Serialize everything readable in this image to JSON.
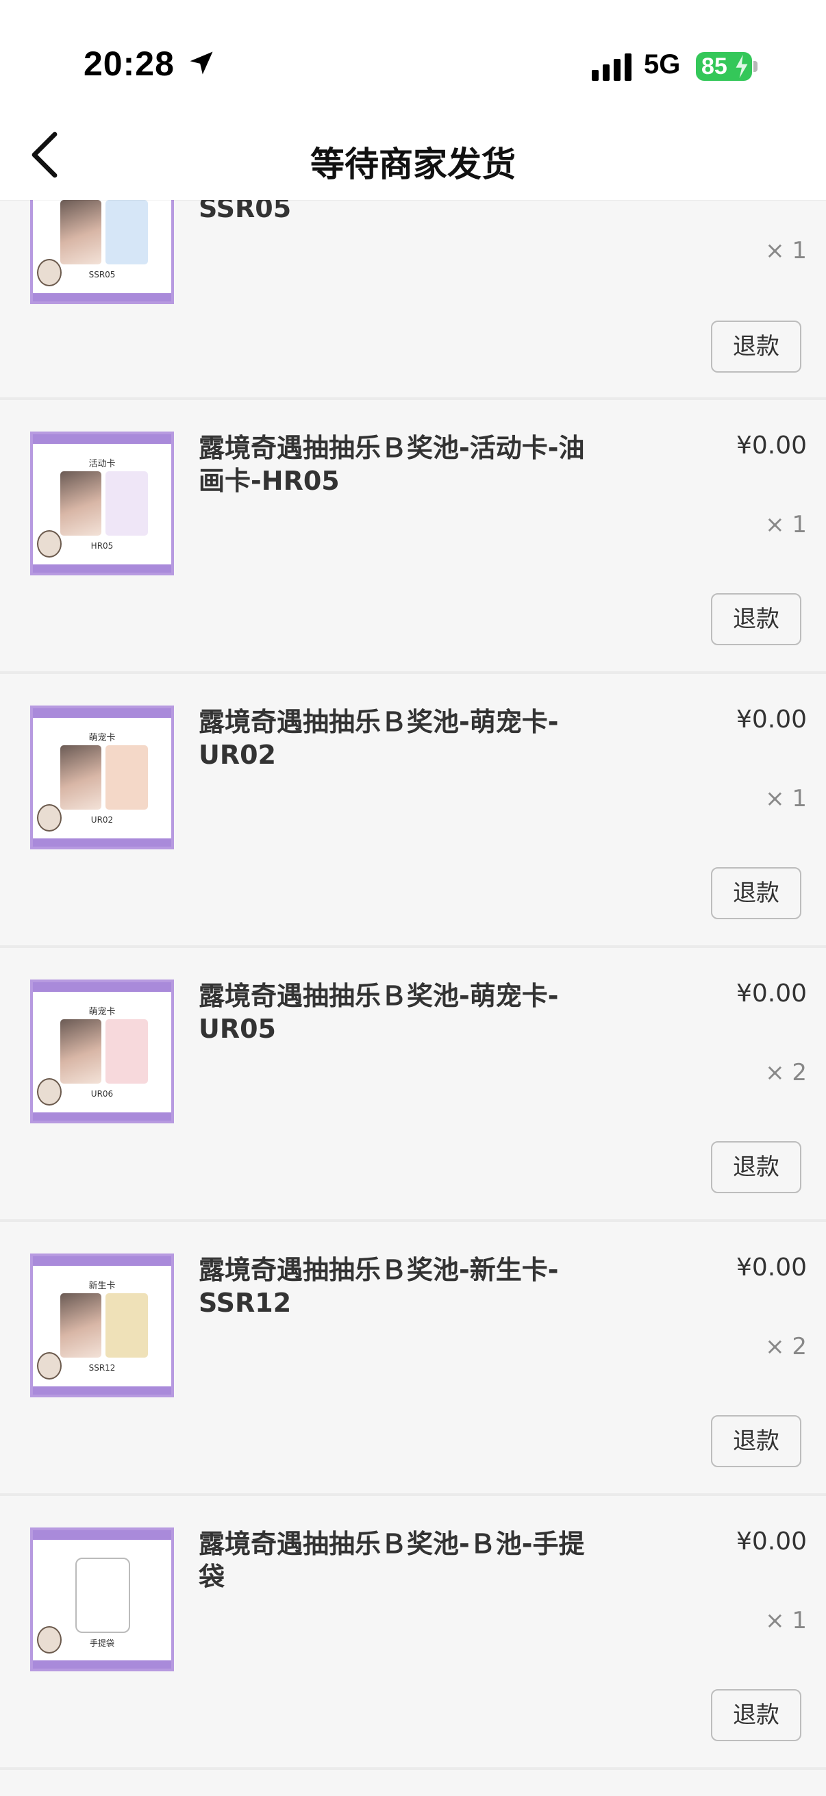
{
  "status": {
    "time": "20:28",
    "network": "5G",
    "battery": "85"
  },
  "nav": {
    "title": "等待商家发货"
  },
  "items": [
    {
      "title": "SSR05",
      "price": "",
      "qty": "× 1",
      "refund": "退款",
      "thumb_label": "",
      "thumb_caption": "SSR05"
    },
    {
      "title": "露境奇遇抽抽乐Ｂ奖池-活动卡-油画卡-HR05",
      "price": "¥0.00",
      "qty": "× 1",
      "refund": "退款",
      "thumb_label": "活动卡",
      "thumb_caption": "HR05"
    },
    {
      "title": "露境奇遇抽抽乐Ｂ奖池-萌宠卡-UR02",
      "price": "¥0.00",
      "qty": "× 1",
      "refund": "退款",
      "thumb_label": "萌宠卡",
      "thumb_caption": "UR02"
    },
    {
      "title": "露境奇遇抽抽乐Ｂ奖池-萌宠卡-UR05",
      "price": "¥0.00",
      "qty": "× 2",
      "refund": "退款",
      "thumb_label": "萌宠卡",
      "thumb_caption": "UR06"
    },
    {
      "title": "露境奇遇抽抽乐Ｂ奖池-新生卡-SSR12",
      "price": "¥0.00",
      "qty": "× 2",
      "refund": "退款",
      "thumb_label": "新生卡",
      "thumb_caption": "SSR12"
    },
    {
      "title": "露境奇遇抽抽乐Ｂ奖池-Ｂ池-手提袋",
      "price": "¥0.00",
      "qty": "× 1",
      "refund": "退款",
      "thumb_label": "",
      "thumb_caption": "手提袋"
    }
  ]
}
